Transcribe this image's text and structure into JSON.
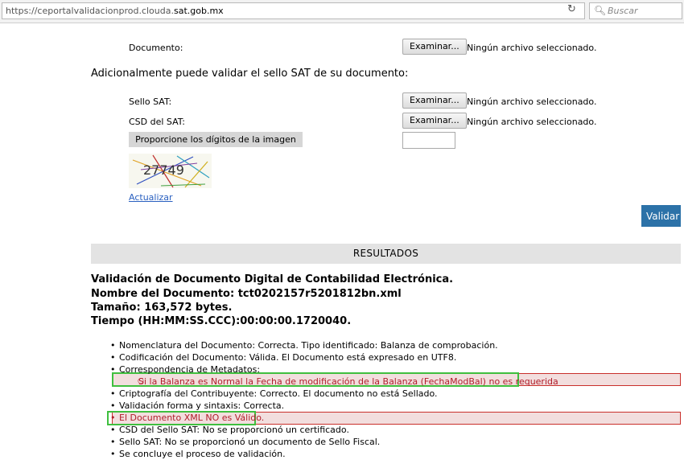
{
  "browser": {
    "url_prefix": "https://ceportalvalidacionprod.clouda.",
    "url_domain": "sat.gob.mx",
    "search_placeholder": "Buscar"
  },
  "form": {
    "documento_label": "Documento:",
    "browse_label": "Examinar...",
    "no_file_text": "Ningún archivo seleccionado.",
    "additional_heading": "Adicionalmente puede validar el sello SAT de su documento:",
    "sello_label": "Sello SAT:",
    "csd_label": "CSD del SAT:",
    "captcha_prompt": "Proporcione los dígitos de la imagen",
    "captcha_text": "27749",
    "refresh_link": "Actualizar",
    "submit_label": "Validar"
  },
  "results": {
    "header": "RESULTADOS",
    "title": "Validación de Documento Digital de Contabilidad Electrónica.",
    "doc_name": "Nombre del Documento: tct0202157r5201812bn.xml",
    "size": "Tamaño: 163,572 bytes.",
    "time": "Tiempo (HH:MM:SS.CCC):00:00:00.1720040.",
    "items": [
      "Nomenclatura del Documento: Correcta. Tipo identificado: Balanza de comprobación.",
      "Codificación del Documento: Válida. El Documento está expresado en UTF8.",
      "Correspondencia de Metadatos:",
      "Si la Balanza es Normal la Fecha de modificación de la Balanza (FechaModBal) no es requerida",
      "Criptografía del Contribuyente: Correcto. El documento no está Sellado.",
      "Validación forma y sintaxis: Correcta.",
      "El Documento XML NO es Válido.",
      "CSD del Sello SAT: No se proporcionó un certificado.",
      "Sello SAT: No se proporcionó un documento de Sello Fiscal.",
      "Se concluye el proceso de validación."
    ]
  },
  "colors": {
    "accent": "#2c72a8",
    "error_text": "#b01d2a",
    "error_bg": "#f2dede",
    "highlight": "#3fbf3f"
  }
}
